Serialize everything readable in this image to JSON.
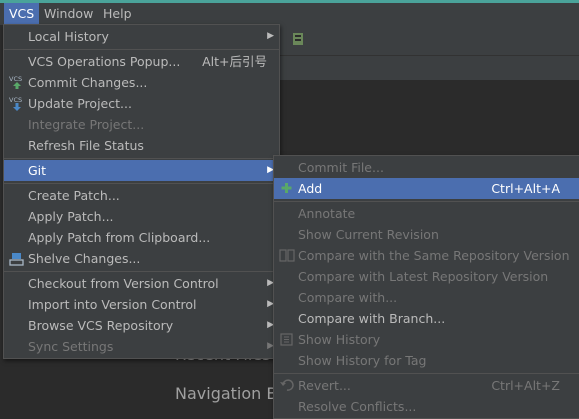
{
  "menubar": {
    "vcs": "VCS",
    "window": "Window",
    "help": "Help"
  },
  "background": {
    "recent_files": "Recent Files",
    "navigation_bar": "Navigation Bar"
  },
  "vcs_menu": {
    "local_history": "Local History",
    "vcs_ops_popup": "VCS Operations Popup...",
    "vcs_ops_popup_shortcut": "Alt+后引号",
    "commit_changes": "Commit Changes...",
    "update_project": "Update Project...",
    "integrate_project": "Integrate Project...",
    "refresh_file_status": "Refresh File Status",
    "git": "Git",
    "create_patch": "Create Patch...",
    "apply_patch": "Apply Patch...",
    "apply_patch_clipboard": "Apply Patch from Clipboard...",
    "shelve_changes": "Shelve Changes...",
    "checkout_vc": "Checkout from Version Control",
    "import_vc": "Import into Version Control",
    "browse_vcs_repo": "Browse VCS Repository",
    "sync_settings": "Sync Settings"
  },
  "git_menu": {
    "commit_file": "Commit File...",
    "add": "Add",
    "add_shortcut": "Ctrl+Alt+A",
    "annotate": "Annotate",
    "show_current_revision": "Show Current Revision",
    "compare_same_repo": "Compare with the Same Repository Version",
    "compare_latest_repo": "Compare with Latest Repository Version",
    "compare_with": "Compare with...",
    "compare_branch": "Compare with Branch...",
    "show_history": "Show History",
    "show_history_tag": "Show History for Tag",
    "revert": "Revert...",
    "revert_shortcut": "Ctrl+Alt+Z",
    "resolve_conflicts": "Resolve Conflicts..."
  },
  "colors": {
    "accent": "#4b6eaf",
    "menu_bg": "#3c3f41",
    "editor_bg": "#2b2b2b",
    "add_icon": "#59a869"
  }
}
